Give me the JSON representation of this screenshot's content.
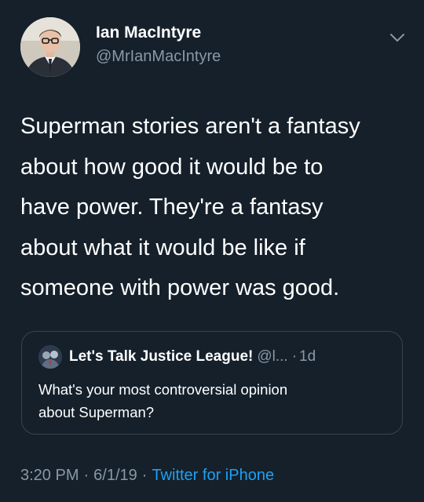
{
  "author": {
    "display_name": "Ian MacIntyre",
    "handle": "@MrIanMacIntyre"
  },
  "icons": {
    "more": "chevron-down-icon",
    "avatar": "profile-photo",
    "quote_avatar": "justice-league-avatar"
  },
  "tweet": {
    "text_lines": [
      "Superman stories aren't a fantasy",
      "about how good it would be to",
      "have power. They're a fantasy",
      "about what it would be like if",
      "someone with power was good."
    ]
  },
  "quoted_tweet": {
    "name": "Let's Talk Justice League!",
    "handle": "@l...",
    "dot": "·",
    "time": "1d",
    "text_lines": [
      "What's your most controversial opinion",
      "about Superman?"
    ]
  },
  "meta": {
    "time": "3:20 PM",
    "sep1": "·",
    "date": "6/1/19",
    "sep2": "·",
    "source": "Twitter for iPhone"
  },
  "colors": {
    "background": "#15202b",
    "secondary_text": "#8899a6",
    "link": "#1da1f2",
    "border": "#38444d"
  }
}
